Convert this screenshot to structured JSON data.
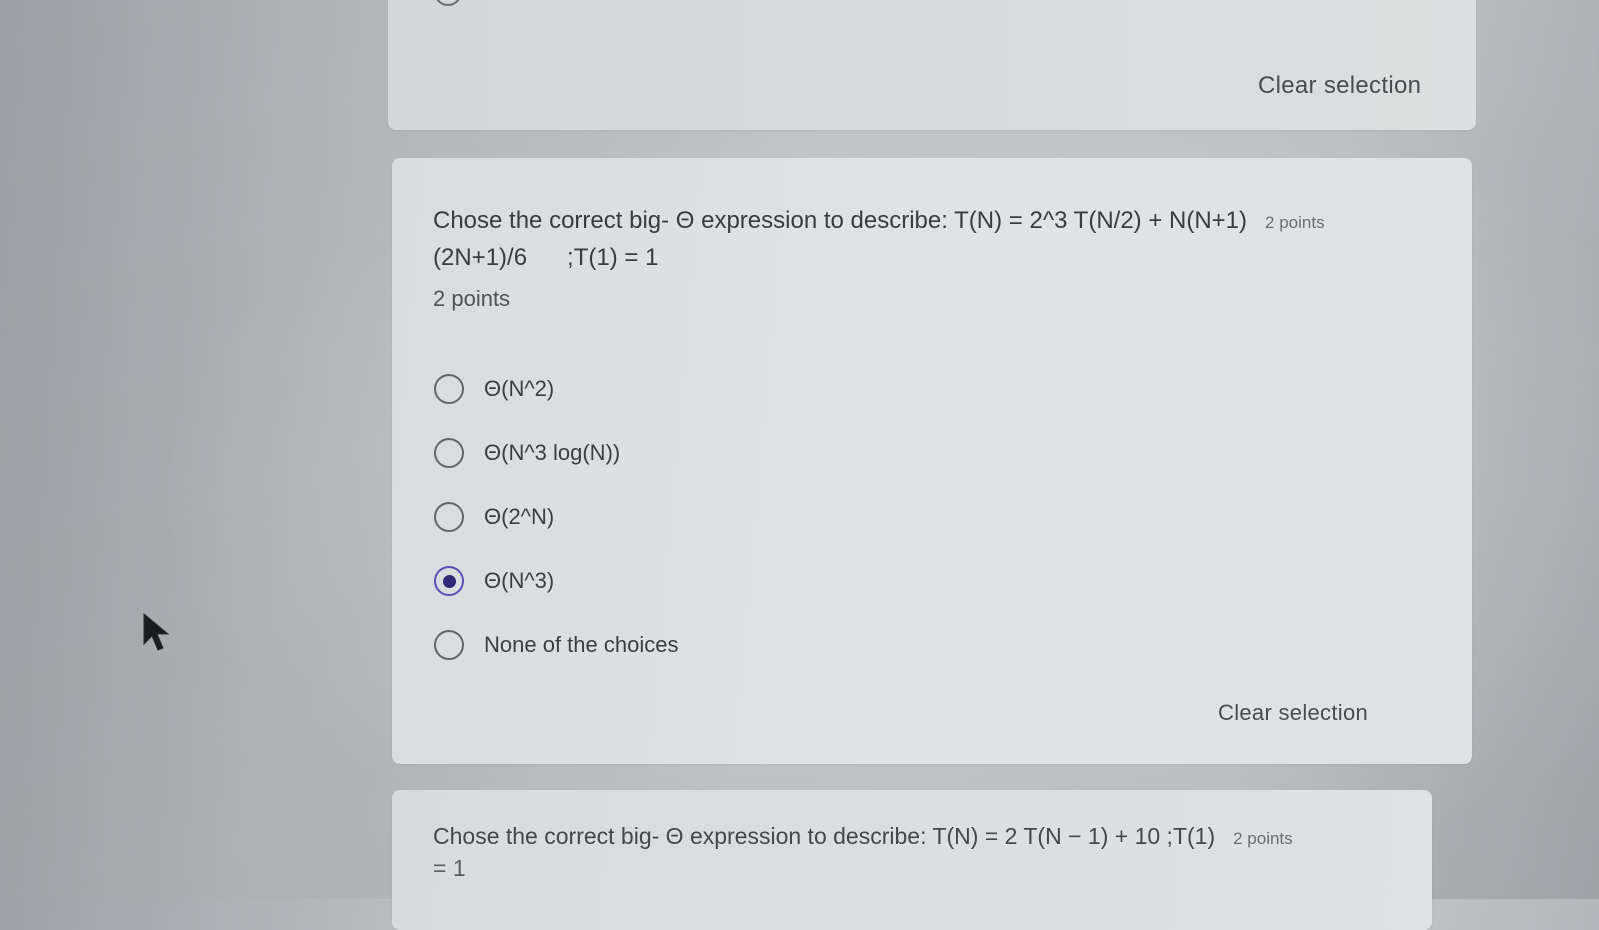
{
  "previous_question": {
    "clear_selection": "Clear selection"
  },
  "question": {
    "text_line1": "Chose the correct big- Θ expression to describe: T(N) = 2^3 T(N/2) + N(N+1)",
    "points_tag": "2 points",
    "text_line2": "(2N+1)/6      ;T(1) = 1",
    "points": "2 points",
    "options": [
      {
        "label": "Θ(N^2)",
        "selected": false
      },
      {
        "label": "Θ(N^3 log(N))",
        "selected": false
      },
      {
        "label": "Θ(2^N)",
        "selected": false
      },
      {
        "label": "Θ(N^3)",
        "selected": true
      },
      {
        "label": "None of the choices",
        "selected": false
      }
    ],
    "clear_selection": "Clear selection"
  },
  "next_question": {
    "text_line1": "Chose the correct big- Θ expression to describe: T(N) = 2 T(N − 1) + 10 ;T(1)",
    "points_tag": "2 points",
    "text_line2": "= 1"
  },
  "colors": {
    "radio_selected": "#5c4fb8",
    "radio_dot": "#2e2a78"
  },
  "icons": {
    "cursor": "mouse-pointer-icon"
  }
}
